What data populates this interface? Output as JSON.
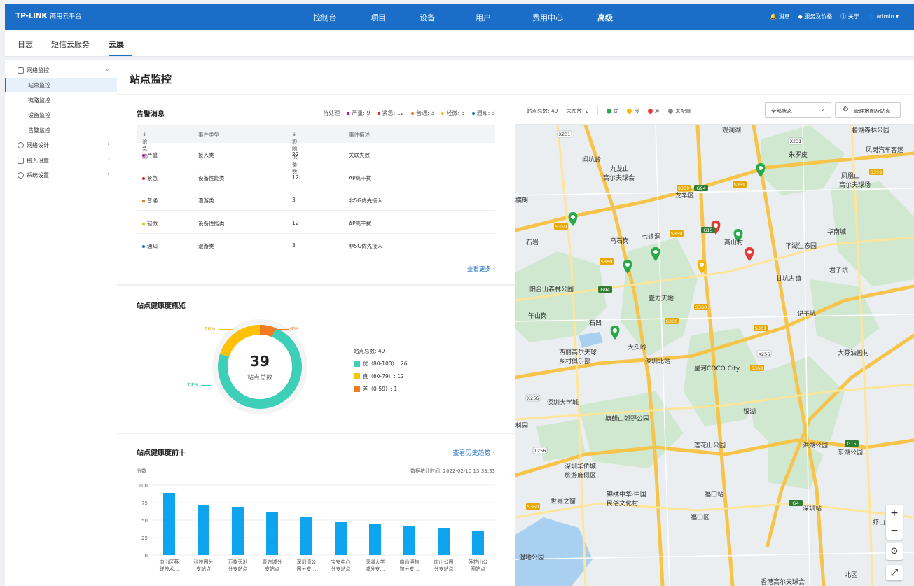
{
  "topbar": {
    "logo": "TP-LINK",
    "app_name": "商用云平台",
    "nav": [
      "控制台",
      "项目",
      "设备",
      "用户",
      "费用中心",
      "高级"
    ],
    "active_nav": "高级",
    "right": {
      "messages": "消息",
      "service": "服务及价格",
      "about": "关于",
      "user": "admin"
    }
  },
  "subtabs": [
    "日志",
    "短信云服务",
    "云展"
  ],
  "active_subtab": "云展",
  "sidebar": {
    "groups": [
      {
        "label": "网络监控",
        "items": [
          "站点监控",
          "链路监控",
          "设备监控",
          "告警监控"
        ]
      },
      {
        "label": "网络设计"
      },
      {
        "label": "接入设置"
      },
      {
        "label": "系统设置"
      }
    ],
    "selected": "站点监控"
  },
  "page": {
    "title": "站点监控"
  },
  "alarm": {
    "title": "告警消息",
    "pending_label": "待处理",
    "summary": [
      {
        "label": "严重: 9",
        "color": "#c000c0"
      },
      {
        "label": "紧急: 12",
        "color": "#e02020"
      },
      {
        "label": "普通: 3",
        "color": "#f07010"
      },
      {
        "label": "轻微: 3",
        "color": "#f5c000"
      },
      {
        "label": "通知: 3",
        "color": "#1a6ec8"
      }
    ],
    "columns": [
      "紧急度",
      "事件类型",
      "影响设备数",
      "事件描述"
    ],
    "rows": [
      {
        "level": "严重",
        "type": "接入类",
        "count": "22",
        "desc": "关联失败",
        "color": "#c000c0"
      },
      {
        "level": "紧急",
        "type": "设备性能类",
        "count": "12",
        "desc": "AP高干扰",
        "color": "#e02020"
      },
      {
        "level": "普通",
        "type": "漫游类",
        "count": "3",
        "desc": "非5G优先接入",
        "color": "#f07010"
      },
      {
        "level": "轻微",
        "type": "设备性能类",
        "count": "12",
        "desc": "AP高干扰",
        "color": "#f5c000"
      },
      {
        "level": "通知",
        "type": "漫游类",
        "count": "3",
        "desc": "非5G优先接入",
        "color": "#1a6ec8"
      }
    ],
    "more": "查看更多 ›"
  },
  "health": {
    "title": "站点健康度概览",
    "total": "39",
    "total_label": "站点总数",
    "pct_good": "20%",
    "pct_bad": "6%",
    "pct_excellent": "74%",
    "legend_total": "站点总数: 49",
    "legend": [
      {
        "label": "优（80-100）: 26",
        "color": "#3ecfb8"
      },
      {
        "label": "良（60-79）: 12",
        "color": "#ffc107"
      },
      {
        "label": "差（0-59）: 1",
        "color": "#f47a20"
      }
    ]
  },
  "top10": {
    "title": "站点健康度前十",
    "link": "查看历史趋势 ›",
    "ylabel": "分数",
    "timestamp": "数据统计时间: 2022-02-10 13:33:33"
  },
  "chart_data": {
    "type": "bar",
    "categories": [
      [
        "南山区蔡",
        "联技术…"
      ],
      [
        "科技园分",
        "支站点"
      ],
      [
        "万象天地",
        "分支站点"
      ],
      [
        "壹方城分",
        "支站点"
      ],
      [
        "深圳湾公",
        "园分支…"
      ],
      [
        "宝安中心",
        "分支站点"
      ],
      [
        "深圳大学",
        "城分支…"
      ],
      [
        "南山博物",
        "馆分支…"
      ],
      [
        "南山公园",
        "分支站点"
      ],
      [
        "莲花山公",
        "园站点"
      ]
    ],
    "values": [
      89,
      71,
      69,
      62,
      54,
      47,
      44,
      42,
      39,
      35
    ],
    "ylim": [
      0,
      100
    ],
    "yticks": [
      "0",
      "25",
      "50",
      "75",
      "100"
    ],
    "color": "#0fa4ee"
  },
  "map": {
    "stat_total": "站点总数: 49",
    "stat_undeployed": "未布放: 2",
    "legend": [
      {
        "label": "优",
        "color": "#2aa84a"
      },
      {
        "label": "良",
        "color": "#f5b800"
      },
      {
        "label": "差",
        "color": "#e53935"
      },
      {
        "label": "未配置",
        "color": "#888888"
      }
    ],
    "status_select": "全部状态",
    "manage_button": "管理地图及站点",
    "labels": [
      {
        "t": "观澜湖"
      },
      {
        "t": "碧湖森林公园"
      },
      {
        "t": "凤岗汽车客运"
      },
      {
        "t": "朱罗皮"
      },
      {
        "t": "凤凰山"
      },
      {
        "t": "高尔夫球场"
      },
      {
        "t": "闻坑岭"
      },
      {
        "t": "九龙山"
      },
      {
        "t": "高尔夫球会"
      },
      {
        "t": "龙华区"
      },
      {
        "t": "华南城"
      },
      {
        "t": "横朗"
      },
      {
        "t": "石岩"
      },
      {
        "t": "乌石岗"
      },
      {
        "t": "七娘洞"
      },
      {
        "t": "高山村"
      },
      {
        "t": "平湖生态园"
      },
      {
        "t": "君子坑"
      },
      {
        "t": "甘坑古镇"
      },
      {
        "t": "阳台山森林公园"
      },
      {
        "t": "壹方天地"
      },
      {
        "t": "午山岗"
      },
      {
        "t": "石凹"
      },
      {
        "t": "大头岭"
      },
      {
        "t": "记子坑"
      },
      {
        "t": "西丽高尔夫球"
      },
      {
        "t": "乡村俱乐部"
      },
      {
        "t": "深圳北站"
      },
      {
        "t": "星河COCO City"
      },
      {
        "t": "大芬油画村"
      },
      {
        "t": "深圳大学城"
      },
      {
        "t": "塘朗山郊野公园"
      },
      {
        "t": "银湖"
      },
      {
        "t": "洪湖公园"
      },
      {
        "t": "莲花山公园"
      },
      {
        "t": "东湖公园"
      },
      {
        "t": "深圳华侨城"
      },
      {
        "t": "旅游度假区"
      },
      {
        "t": "锦绣中华·中国"
      },
      {
        "t": "民俗文化村"
      },
      {
        "t": "世界之窗"
      },
      {
        "t": "福田站"
      },
      {
        "t": "深圳站"
      },
      {
        "t": "福田区"
      },
      {
        "t": "虾山"
      },
      {
        "t": "湿地公园"
      },
      {
        "t": "香港高尔夫球会"
      },
      {
        "t": "北区"
      },
      {
        "t": "科园"
      }
    ],
    "shields": [
      {
        "t": "X231"
      },
      {
        "t": "X231"
      },
      {
        "t": "S359"
      },
      {
        "t": "G94"
      },
      {
        "t": "S359"
      },
      {
        "t": "S359"
      },
      {
        "t": "S359"
      },
      {
        "t": "G15"
      },
      {
        "t": "S359"
      },
      {
        "t": "S360"
      },
      {
        "t": "G94"
      },
      {
        "t": "S360"
      },
      {
        "t": "S360"
      },
      {
        "t": "S301"
      },
      {
        "t": "S360"
      },
      {
        "t": "X256"
      },
      {
        "t": "X256"
      },
      {
        "t": "X256"
      },
      {
        "t": "S360"
      },
      {
        "t": "G15"
      },
      {
        "t": "G4"
      }
    ],
    "zoom_in": "+",
    "zoom_out": "−"
  }
}
